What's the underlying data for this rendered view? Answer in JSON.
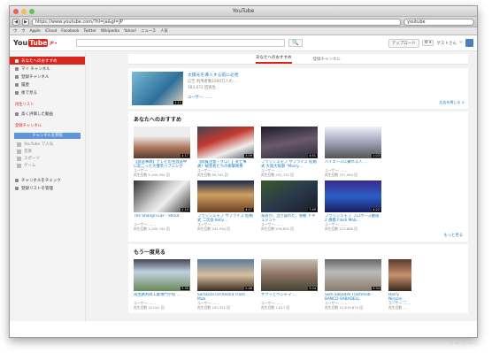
{
  "window": {
    "title": "YouTube"
  },
  "browser": {
    "back": "◀",
    "forward": "▶",
    "url": "https://www.youtube.com/?hl=ja&gl=JP",
    "search_value": "youtube",
    "bookmarks": [
      "ウ",
      "ウ",
      "Apple",
      "iCloud",
      "Facebook",
      "Twitter",
      "Wikipedia",
      "Yahoo!",
      "ニュース",
      "人気"
    ]
  },
  "header": {
    "logo_you": "You",
    "logo_tube": "Tube",
    "logo_caret": "JP ▾",
    "search_button": "🔍",
    "upload": "アップロード",
    "gear": "⚙ ▾",
    "user": "ゲストさん"
  },
  "sidebar": {
    "items": [
      {
        "label": "あなたへのおすすめ",
        "selected": true
      },
      {
        "label": "マイ チャンネル"
      },
      {
        "label": "登録チャンネル"
      },
      {
        "label": "履歴"
      },
      {
        "label": "後で見る"
      }
    ],
    "section_playlists": "再生リスト",
    "playlist_items": [
      {
        "label": "高く評価した動画"
      }
    ],
    "section_subs": "登録チャンネル",
    "channel_button": "チャンネルを参照",
    "channels": [
      {
        "label": "YouTube で人気"
      },
      {
        "label": "音楽"
      },
      {
        "label": "スポーツ"
      },
      {
        "label": "ゲーム"
      }
    ],
    "bottom_items": [
      {
        "label": "チャンネルをチェック"
      },
      {
        "label": "登録リストを管理"
      }
    ]
  },
  "tabs": [
    {
      "label": "あなたへのおすすめ",
      "active": true
    },
    {
      "label": "登録チャンネル",
      "active": false
    }
  ],
  "feature": {
    "title": "太陽光を導入する前に必見",
    "meta": "広告  利用者数1000万人の…",
    "views": "183,672 回再生",
    "user": "ユーザー: ……",
    "duration": "1:11",
    "dismiss": "広告を閉じる ×"
  },
  "rec": {
    "title": "あなたへのおすすめ",
    "more": "もっと見る",
    "videos": [
      {
        "title": "【放送事故】テレビの生放送中に起こった大爆笑ハプニング",
        "user": "ユーザー: ……",
        "views": "再生回数 5,260,504 回",
        "duration": "4:17"
      },
      {
        "title": "【閲覧注意・グロ！】死亡事故！被害者たちの衝撃映像",
        "user": "ユーザー: ……",
        "views": "再生回数 89,341 回",
        "duration": "3:09"
      },
      {
        "title": "フラッシュモブ サプライズ 結婚式 大阪大阪駅 \"Marry…",
        "user": "ユーザー: ……",
        "views": "再生回数 291,721 回",
        "duration": "4:51"
      },
      {
        "title": "ハイエースに乗れる人 …",
        "user": "ユーザー: ……",
        "views": "再生回数 757,064 回",
        "duration": "1:03"
      },
      {
        "title": "The Shangri-Las - Shout",
        "user": "ユーザー: ……",
        "views": "再生回数 2,280,744 回",
        "duration": "2:10"
      },
      {
        "title": "フラッシュモブ サプライズ 結婚式 二次会 Kelly…",
        "user": "ユーザー: ……",
        "views": "再生回数 241,594 回",
        "duration": "4:07"
      },
      {
        "title": "家族が、泣き崩れた、感動 ドキュメント",
        "user": "ユーザー: ……",
        "views": "再生回数 976,852 回",
        "duration": "7:49"
      },
      {
        "title": "フラッシュモブ プロポーズ動画 2 規模 Flash Mob…",
        "user": "ユーザー: ……",
        "views": "再生回数 223,888 回",
        "duration": "4:22"
      }
    ]
  },
  "again": {
    "title": "もう一度見る",
    "videos": [
      {
        "title": "南生路利政工業専門学校 …",
        "user": "ユーザー: ……",
        "views": "再生回数 10,041 回",
        "duration": "3:30"
      },
      {
        "title": "Sarasota Orchestra Flash Mob",
        "user": "ユーザー: ……",
        "views": "再生回数 100,322 回",
        "duration": "2:48"
      },
      {
        "title": "サクッとベンチマ …",
        "user": "ユーザー: ……",
        "views": "再生回数 1,817 回",
        "duration": "3:04"
      },
      {
        "title": "Som Sabadell Flashmob - BANCO SABADELL",
        "user": "ユーザー: ……",
        "views": "再生回数 41,819,875 回",
        "duration": "5:34"
      },
      {
        "title": "Harry Nilsson 1972 (HD)",
        "user": "ユーザー: ……",
        "views": "再生回数 …",
        "duration": ""
      }
    ]
  },
  "watermark": "ちょっと…"
}
